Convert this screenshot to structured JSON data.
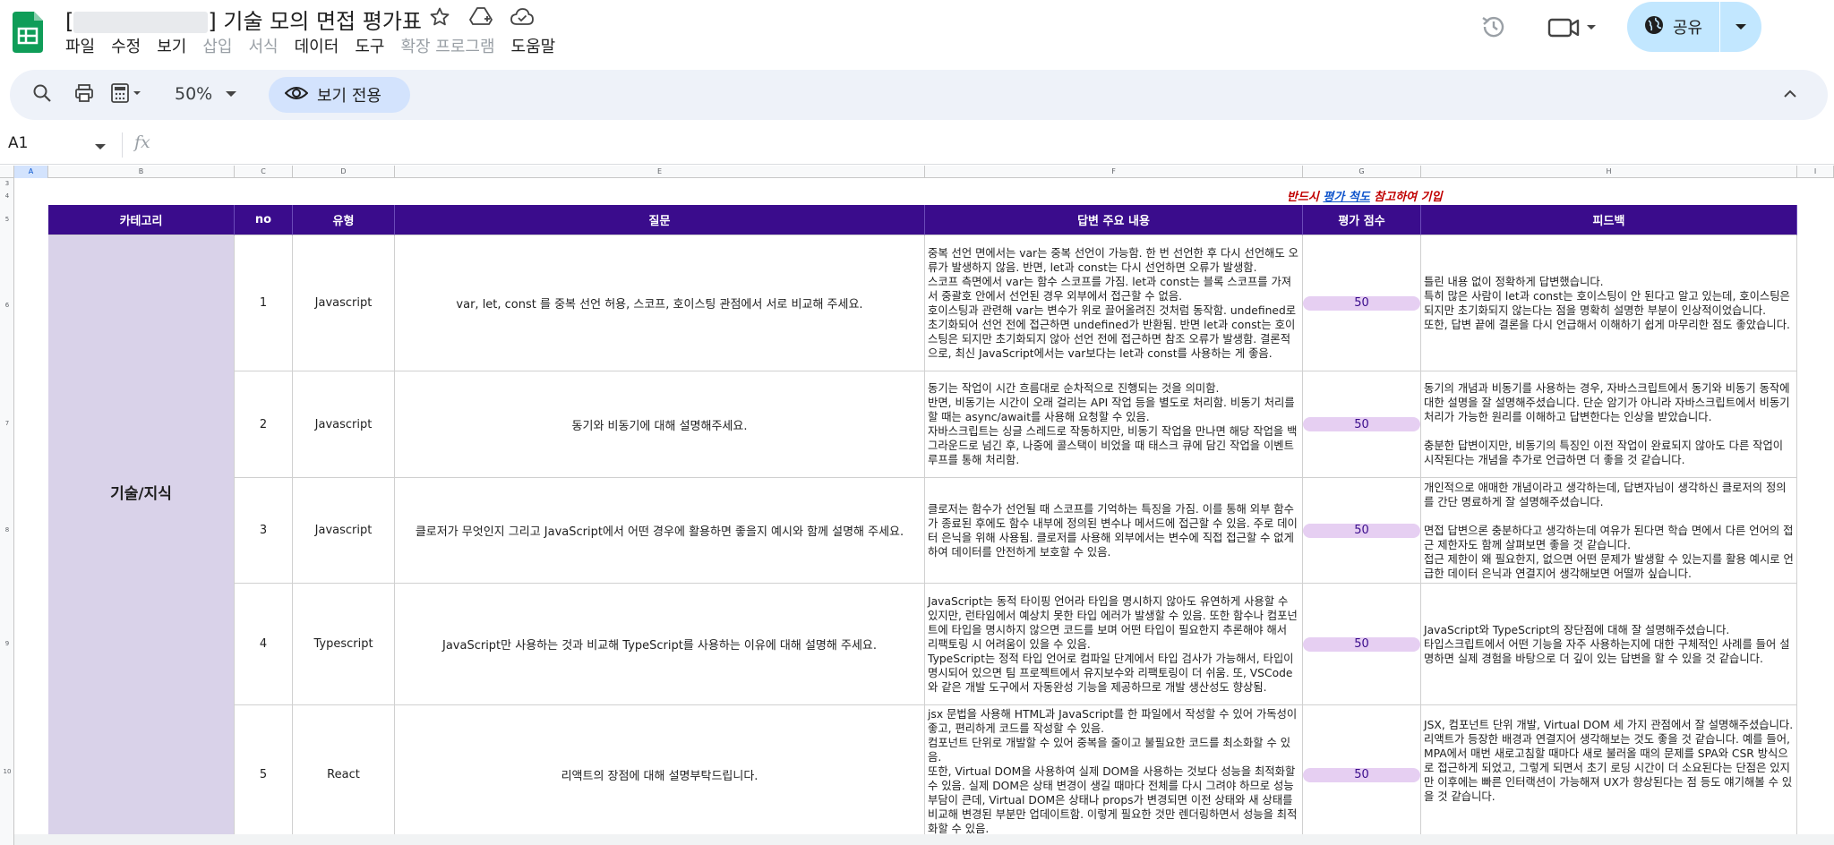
{
  "app": {
    "title_prefix": "[",
    "title_main": "] 기술 모의 면접 평가표",
    "menu": [
      {
        "label": "파일",
        "enabled": true
      },
      {
        "label": "수정",
        "enabled": true
      },
      {
        "label": "보기",
        "enabled": true
      },
      {
        "label": "삽입",
        "enabled": false
      },
      {
        "label": "서식",
        "enabled": false
      },
      {
        "label": "데이터",
        "enabled": true
      },
      {
        "label": "도구",
        "enabled": true
      },
      {
        "label": "확장 프로그램",
        "enabled": false
      },
      {
        "label": "도움말",
        "enabled": true
      }
    ],
    "share_label": "공유"
  },
  "toolbar": {
    "zoom": "50%",
    "view_only": "보기 전용"
  },
  "formula": {
    "cell_ref": "A1",
    "fx": "fx"
  },
  "columns": [
    "A",
    "B",
    "C",
    "D",
    "E",
    "F",
    "G",
    "H",
    "I"
  ],
  "rows": [
    "3",
    "4",
    "5",
    "6",
    "7",
    "8",
    "9",
    "10"
  ],
  "note": {
    "part1": "반드시 ",
    "link": "평가 척도",
    "part2": " 참고하여 기입"
  },
  "table": {
    "headers": [
      "카테고리",
      "no",
      "유형",
      "질문",
      "답변 주요 내용",
      "평가 점수",
      "피드백"
    ],
    "category": "기술/지식",
    "items": [
      {
        "no": "1",
        "type": "Javascript",
        "question": "var, let, const 를 중복 선언 허용, 스코프, 호이스팅 관점에서 서로 비교해 주세요.",
        "answer": "중복 선언 면에서는 var는 중복 선언이 가능함. 한 번 선언한 후 다시 선언해도 오류가 발생하지 않음. 반면, let과 const는 다시 선언하면 오류가 발생함.\n스코프 측면에서 var는 함수 스코프를 가짐. let과 const는 블록 스코프를 가져서 중괄호 안에서 선언된 경우 외부에서 접근할 수 없음.\n호이스팅과 관련해 var는 변수가 위로 끌어올려진 것처럼 동작함. undefined로 초기화되어 선언 전에 접근하면 undefined가 반환됨. 반면 let과 const는 호이스팅은 되지만 초기화되지 않아 선언 전에 접근하면 참조 오류가 발생함. 결론적으로, 최신 JavaScript에서는 var보다는 let과 const를 사용하는 게 좋음.",
        "score": "50",
        "feedback": "틀린 내용 없이 정확하게 답변했습니다.\n특히 많은 사람이 let과 const는 호이스팅이 안 된다고 알고 있는데, 호이스팅은 되지만 초기화되지 않는다는 점을 명확히 설명한 부분이 인상적이었습니다.\n또한, 답변 끝에 결론을 다시 언급해서 이해하기 쉽게 마무리한 점도 좋았습니다."
      },
      {
        "no": "2",
        "type": "Javascript",
        "question": "동기와 비동기에 대해 설명해주세요.",
        "answer": "동기는 작업이 시간 흐름대로 순차적으로 진행되는 것을 의미함.\n반면, 비동기는 시간이 오래 걸리는 API 작업 등을 별도로 처리함. 비동기 처리를 할 때는 async/await를 사용해 요청할 수 있음.\n자바스크립트는 싱글 스레드로 작동하지만, 비동기 작업을 만나면 해당 작업을 백그라운드로 넘긴 후, 나중에 콜스택이 비었을 때 태스크 큐에 담긴 작업을 이벤트 루프를 통해 처리함.",
        "score": "50",
        "feedback": "동기의 개념과 비동기를 사용하는 경우, 자바스크립트에서 동기와 비동기 동작에 대한 설명을 잘 설명해주셨습니다. 단순 암기가 아니라 자바스크립트에서 비동기 처리가 가능한 원리를 이해하고 답변한다는 인상을 받았습니다.\n\n충분한 답변이지만, 비동기의 특징인 이전 작업이 완료되지 않아도 다른 작업이 시작된다는 개념을 추가로 언급하면 더 좋을 것 같습니다."
      },
      {
        "no": "3",
        "type": "Javascript",
        "question": "클로저가 무엇인지 그리고 JavaScript에서 어떤 경우에 활용하면 좋을지 예시와 함께 설명해 주세요.",
        "answer": "클로저는 함수가 선언될 때 스코프를 기억하는 특징을 가짐. 이를 통해 외부 함수가 종료된 후에도 함수 내부에 정의된 변수나 메서드에 접근할 수 있음. 주로 데이터 은닉을 위해 사용됨. 클로저를 사용해 외부에서는 변수에 직접 접근할 수 없게 하여 데이터를 안전하게 보호할 수 있음.",
        "score": "50",
        "feedback": "개인적으로 애매한 개념이라고 생각하는데, 답변자님이 생각하신 클로저의 정의를 간단 명료하게 잘 설명해주셨습니다.\n\n면접 답변으론 충분하다고 생각하는데 여유가 된다면 학습 면에서 다른 언어의 접근 제한자도 함께 살펴보면 좋을 것 같습니다.\n접근 제한이 왜 필요한지, 없으면 어떤 문제가 발생할 수 있는지를 활용 예시로 언급한 데이터 은닉과 연결지어 생각해보면 어떨까 싶습니다."
      },
      {
        "no": "4",
        "type": "Typescript",
        "question": "JavaScript만 사용하는 것과 비교해 TypeScript를 사용하는 이유에 대해 설명해 주세요.",
        "answer": "JavaScript는 동적 타이핑 언어라 타입을 명시하지 않아도 유연하게 사용할 수 있지만, 런타임에서 예상치 못한 타입 에러가 발생할 수 있음. 또한 함수나 컴포넌트에 타입을 명시하지 않으면 코드를 보며 어떤 타입이 필요한지 추론해야 해서 리팩토링 시 어려움이 있을 수 있음.\nTypeScript는 정적 타입 언어로 컴파일 단계에서 타입 검사가 가능해서, 타입이 명시되어 있으면 팀 프로젝트에서 유지보수와 리팩토링이 더 쉬움. 또, VSCode와 같은 개발 도구에서 자동완성 기능을 제공하므로 개발 생산성도 향상됨.",
        "score": "50",
        "feedback": "JavaScript와 TypeScript의 장단점에 대해 잘 설명해주셨습니다.\n타입스크립트에서 어떤 기능을 자주 사용하는지에 대한 구체적인 사례를 들어 설명하면 실제 경험을 바탕으로 더 깊이 있는 답변을 할 수 있을 것 같습니다."
      },
      {
        "no": "5",
        "type": "React",
        "question": "리액트의 장점에 대해 설명부탁드립니다.",
        "answer": "jsx 문법을 사용해 HTML과 JavaScript를 한 파일에서 작성할 수 있어 가독성이 좋고, 편리하게 코드를 작성할 수 있음.\n컴포넌트 단위로 개발할 수 있어 중복을 줄이고 불필요한 코드를 최소화할 수 있음.\n또한, Virtual DOM을 사용하여 실제 DOM을 사용하는 것보다 성능을 최적화할 수 있음. 실제 DOM은 상태 변경이 생길 때마다 전체를 다시 그려야 하므로 성능 부담이 큰데, Virtual DOM은 상태나 props가 변경되면 이전 상태와 새 상태를 비교해 변경된 부분만 업데이트함. 이렇게 필요한 것만 렌더링하면서 성능을 최적화할 수 있음.",
        "score": "50",
        "feedback": "JSX, 컴포넌트 단위 개발, Virtual DOM 세 가지 관점에서 잘 설명해주셨습니다.\n리액트가 등장한 배경과 연결지어 생각해보는 것도 좋을 것 같습니다. 예를 들어, MPA에서 매번 새로고침할 때마다 새로 불러올 때의 문제를 SPA와 CSR 방식으로 접근하게 되었고, 그렇게 되면서 초기 로딩 시간이 더 소요된다는 단점은 있지만 이후에는 빠른 인터랙션이 가능해져 UX가 향상된다는 점 등도 얘기해볼 수 있을 것 같습니다."
      }
    ]
  }
}
